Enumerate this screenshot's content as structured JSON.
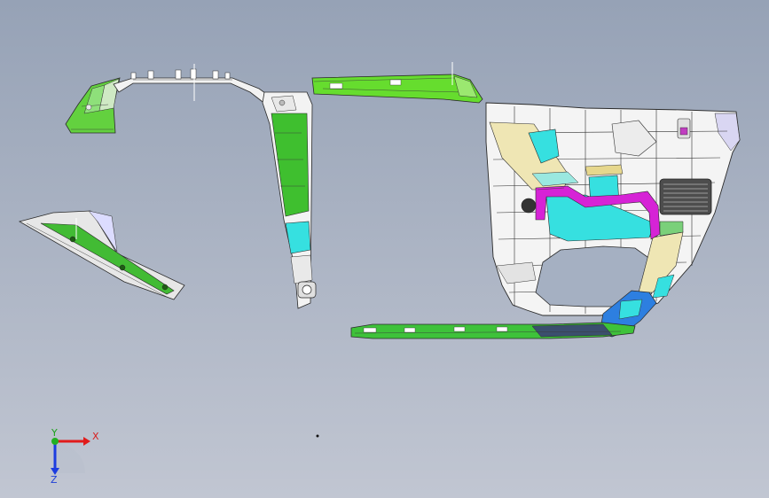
{
  "viewport": {
    "background_top": "#96a2b6",
    "background_bottom": "#c1c6d2"
  },
  "triad": {
    "x_label": "X",
    "y_label": "Y",
    "z_label": "Z",
    "x_color": "#e11b1b",
    "y_color": "#22b022",
    "z_color": "#1c3ce0"
  },
  "parts": [
    {
      "name": "a-pillar-upper-trim",
      "color": "#63d13f"
    },
    {
      "name": "roof-rail-trim",
      "color": "#f2f2f2"
    },
    {
      "name": "b-pillar-trim",
      "color": "#3fbf2f"
    },
    {
      "name": "roof-rail-green-trim",
      "color": "#66dd2e"
    },
    {
      "name": "quarter-panel-trim",
      "color": "#f4f4f4"
    },
    {
      "name": "rocker-sill-trim",
      "color": "#3ec23a"
    },
    {
      "name": "a-pillar-lower-trim",
      "color": "#42bb34"
    },
    {
      "name": "cyan-panel",
      "color": "#36e0e0"
    },
    {
      "name": "magenta-duct",
      "color": "#d623d6"
    },
    {
      "name": "beige-panel",
      "color": "#efe6b4"
    },
    {
      "name": "blue-bracket",
      "color": "#2d7fe0"
    },
    {
      "name": "speaker-grille",
      "color": "#4d4d4d"
    }
  ]
}
